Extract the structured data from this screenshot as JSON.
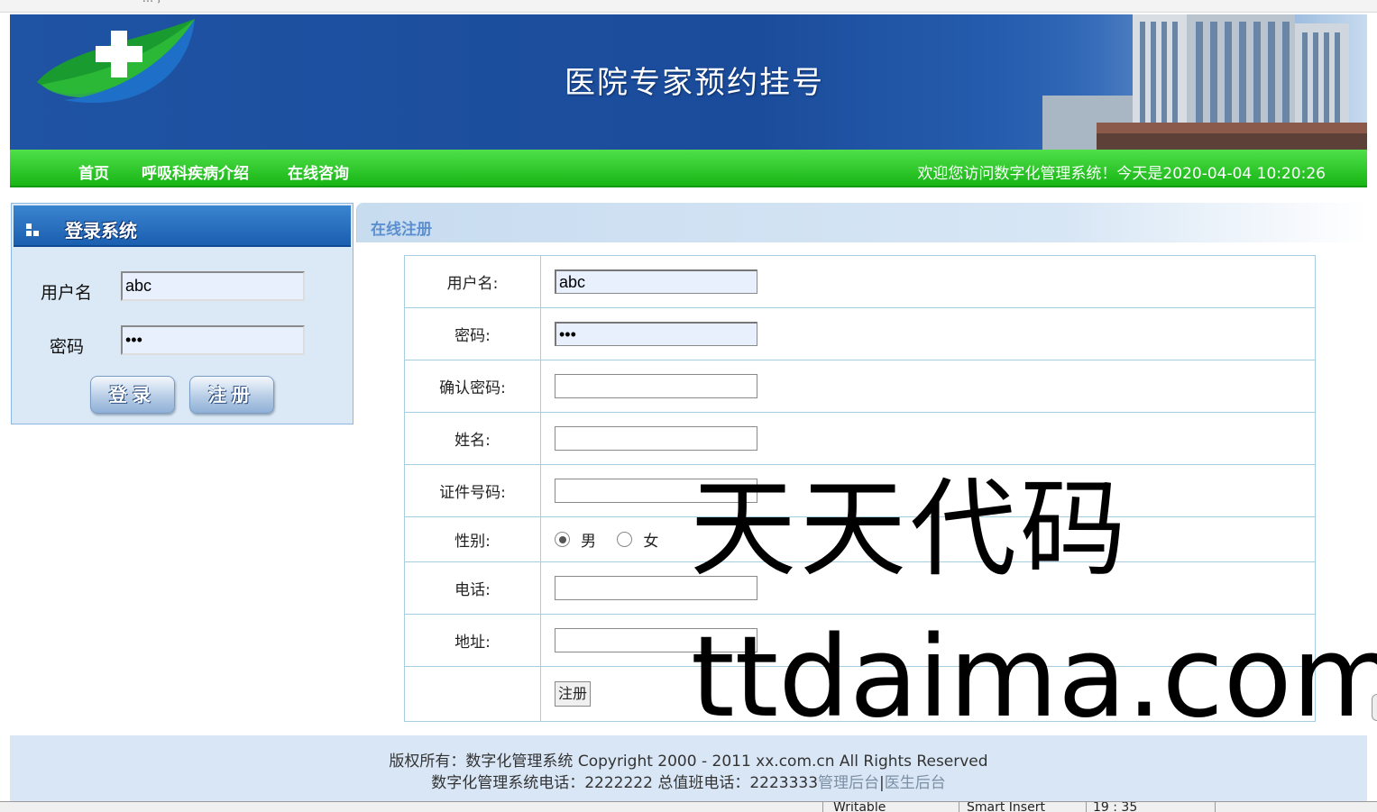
{
  "browser": {
    "tab_fragment": "' ... ,"
  },
  "banner": {
    "title": "医院专家预约挂号"
  },
  "nav": {
    "items": [
      "首页",
      "呼吸科疾病介绍",
      "在线咨询"
    ],
    "welcome": "欢迎您访问数字化管理系统！今天是2020-04-04 10:20:26"
  },
  "login": {
    "title": "登录系统",
    "username_label": "用户名",
    "username_value": "abc",
    "password_label": "密码",
    "password_value": "•••",
    "login_button": "登录",
    "register_button": "注册"
  },
  "register": {
    "section_title": "在线注册",
    "fields": [
      {
        "label": "用户名:",
        "value": "abc"
      },
      {
        "label": "密码:",
        "value": "•••"
      },
      {
        "label": "确认密码:",
        "value": ""
      },
      {
        "label": "姓名:",
        "value": ""
      },
      {
        "label": "证件号码:",
        "value": ""
      },
      {
        "label": "性别:"
      },
      {
        "label": "电话:",
        "value": ""
      },
      {
        "label": "地址:",
        "value": ""
      }
    ],
    "gender_options": [
      "男",
      "女"
    ],
    "gender_selected": "男",
    "submit_label": "注册"
  },
  "watermark": {
    "line1": "天天代码",
    "line2": "ttdaima.com"
  },
  "footer": {
    "line1": "版权所有：数字化管理系统 Copyright 2000 - 2011 xx.com.cn All Rights Reserved",
    "line2_text": "数字化管理系统电话：2222222 总值班电话：2223333",
    "admin_link": "管理后台",
    "separator": "|",
    "doctor_link": "医生后台"
  },
  "statusbar": {
    "items": [
      "Writable",
      "Smart Insert",
      "19 : 35"
    ]
  },
  "colors": {
    "banner": "#1f53a3",
    "nav": "#18b515",
    "footer": "#d9e6f5",
    "table_border": "#a6cde0"
  }
}
